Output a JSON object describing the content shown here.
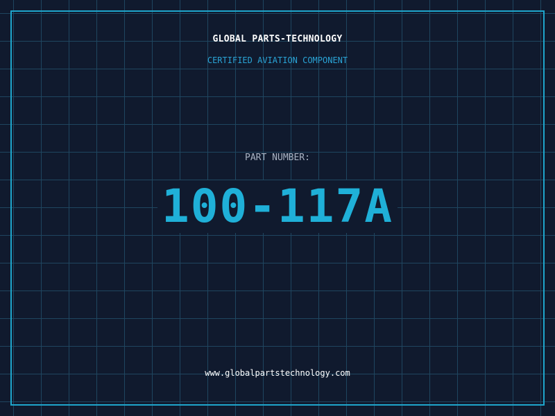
{
  "brand": {
    "name": "GLOBAL PARTS-TECHNOLOGY",
    "tagline": "CERTIFIED AVIATION COMPONENT"
  },
  "part": {
    "label": "PART NUMBER:",
    "number": "100-117A"
  },
  "footer": {
    "url": "www.globalpartstechnology.com"
  },
  "colors": {
    "background": "#101a2e",
    "grid": "#1f4660",
    "frame": "#1ea6cc",
    "accent": "#1fb0d8",
    "label": "#aab4c4",
    "text": "#ffffff"
  }
}
